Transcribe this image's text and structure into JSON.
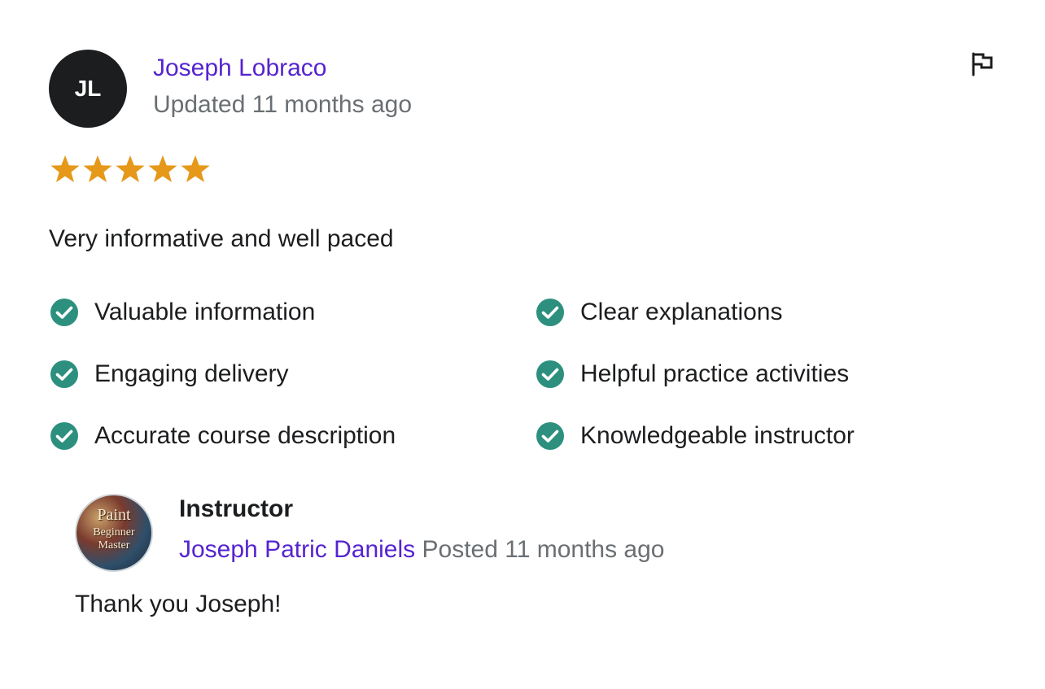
{
  "review": {
    "reviewer": {
      "initials": "JL",
      "name": "Joseph Lobraco",
      "updated": "Updated 11 months ago"
    },
    "rating": 5,
    "rating_color": "#e59819",
    "comment": "Very informative and well paced",
    "tags": [
      {
        "label": "Valuable information"
      },
      {
        "label": "Clear explanations"
      },
      {
        "label": "Engaging delivery"
      },
      {
        "label": "Helpful practice activities"
      },
      {
        "label": "Accurate course description"
      },
      {
        "label": "Knowledgeable instructor"
      }
    ],
    "tag_icon": "check-circle-icon",
    "tag_icon_color": "#2d907f",
    "flag_icon": "flag-icon"
  },
  "instructor_response": {
    "heading": "Instructor",
    "name": "Joseph Patric Daniels",
    "posted": "Posted 11 months ago",
    "avatar_text": [
      "Paint",
      "Beginner",
      "Master"
    ],
    "reply": "Thank you Joseph!"
  },
  "colors": {
    "link": "#5624d0",
    "muted": "#6a6f73",
    "text": "#1c1d1f"
  }
}
